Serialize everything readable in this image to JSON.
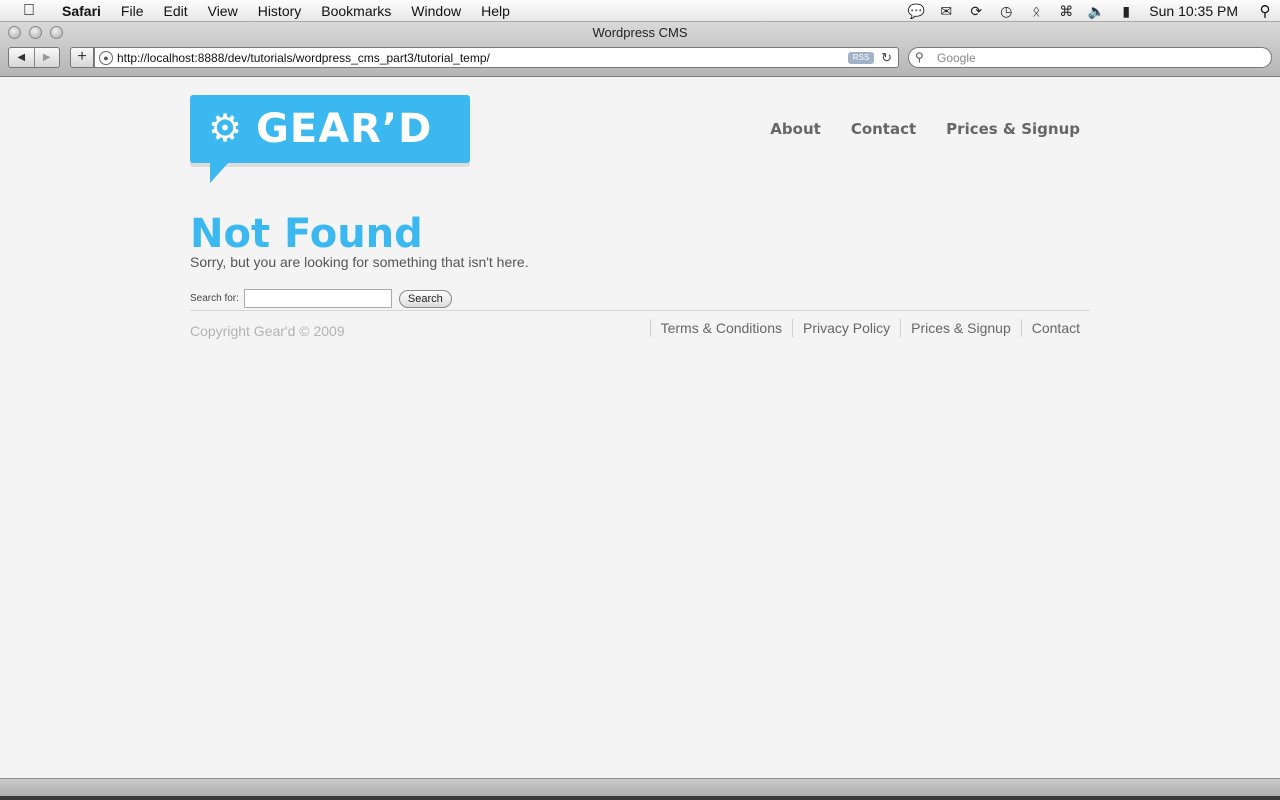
{
  "menubar": {
    "apple": "",
    "items": [
      "Safari",
      "File",
      "Edit",
      "View",
      "History",
      "Bookmarks",
      "Window",
      "Help"
    ],
    "clock": "Sun 10:35 PM",
    "status_icons": [
      "chat-icon",
      "mail-icon",
      "sync-icon",
      "time-machine-icon",
      "bluetooth-icon",
      "wifi-icon",
      "volume-icon",
      "battery-icon"
    ]
  },
  "browser": {
    "window_title": "Wordpress CMS",
    "url": "http://localhost:8888/dev/tutorials/wordpress_cms_part3/tutorial_temp/",
    "rss_label": "RSS",
    "search_placeholder": "Google"
  },
  "site": {
    "brand": "GEAR’D",
    "brand_color": "#3cb8f0",
    "nav": [
      "About",
      "Contact",
      "Prices & Signup"
    ],
    "heading": "Not Found",
    "message": "Sorry, but you are looking for something that isn't here.",
    "search": {
      "label": "Search for:",
      "value": "",
      "button": "Search"
    },
    "copyright": "Copyright Gear'd © 2009",
    "footer_nav": [
      "Terms & Conditions",
      "Privacy Policy",
      "Prices & Signup",
      "Contact"
    ]
  }
}
